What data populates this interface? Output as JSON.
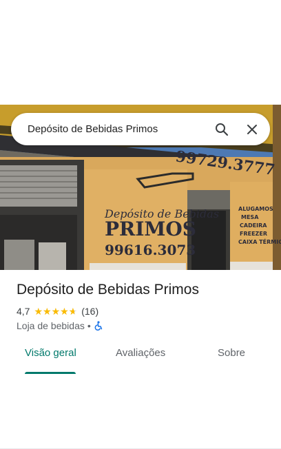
{
  "colors": {
    "accent": "#00796b",
    "star": "#fbbc04",
    "accessibility": "#1a73e8"
  },
  "place_photo": {
    "icon": "storefront-photo"
  },
  "search": {
    "value": "Depósito de Bebidas Primos",
    "search_icon": "search-icon",
    "close_icon": "close-icon"
  },
  "place": {
    "name": "Depósito de Bebidas Primos",
    "rating": "4,7",
    "rating_fraction": 0.94,
    "stars_glyph": "★★★★★",
    "reviews_count": "(16)",
    "category": "Loja de bebidas",
    "separator": "•",
    "accessibility_icon": "wheelchair-icon"
  },
  "tabs": [
    {
      "label": "Visão geral",
      "active": true
    },
    {
      "label": "Avaliações",
      "active": false
    },
    {
      "label": "Sobre",
      "active": false
    }
  ]
}
